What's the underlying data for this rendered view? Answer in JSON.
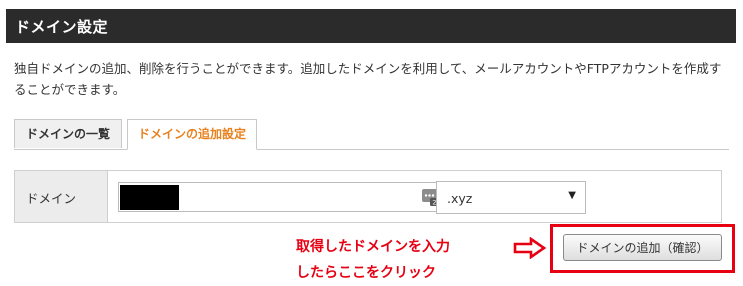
{
  "header": {
    "title": "ドメイン設定"
  },
  "description": "独自ドメインの追加、削除を行うことができます。追加したドメインを利用して、メールアカウントやFTPアカウントを作成することができます。",
  "tabs": [
    {
      "label": "ドメインの一覧",
      "active": false
    },
    {
      "label": "ドメインの追加設定",
      "active": true
    }
  ],
  "form": {
    "domain_label": "ドメイン",
    "domain_value": "",
    "tld_selected": ".xyz"
  },
  "annotation": {
    "line1": "取得したドメインを入力",
    "line2": "したらここをクリック"
  },
  "submit_button": {
    "label": "ドメインの追加（確認）"
  },
  "colors": {
    "header_bg": "#2b2b2b",
    "active_tab_text": "#e8821e",
    "annotation_red": "#e60012"
  },
  "icons": [
    "input-helper-icon",
    "dropdown-arrow-icon",
    "red-arrow-icon"
  ]
}
